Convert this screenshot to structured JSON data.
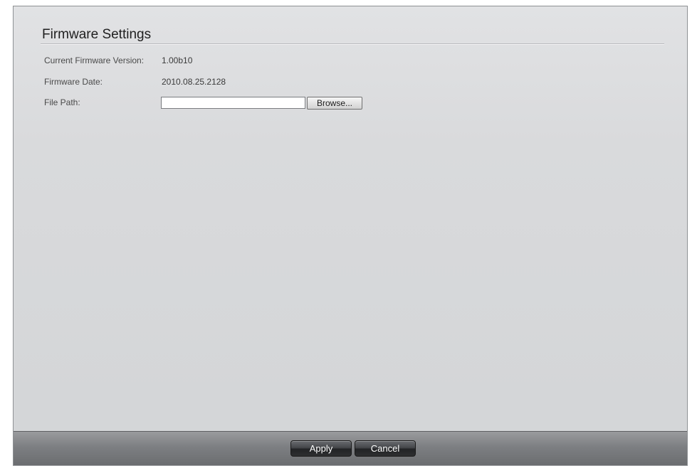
{
  "page": {
    "title": "Firmware Settings"
  },
  "fields": {
    "current_version_label": "Current Firmware Version:",
    "current_version_value": "1.00b10",
    "firmware_date_label": "Firmware Date:",
    "firmware_date_value": "2010.08.25.2128",
    "file_path_label": "File Path:",
    "file_path_value": "",
    "browse_label": "Browse..."
  },
  "footer": {
    "apply_label": "Apply",
    "cancel_label": "Cancel"
  },
  "colors": {
    "panel_background": "#d9dadc",
    "footer_background": "#7d7f82",
    "button_dark": "#2e2f31"
  }
}
